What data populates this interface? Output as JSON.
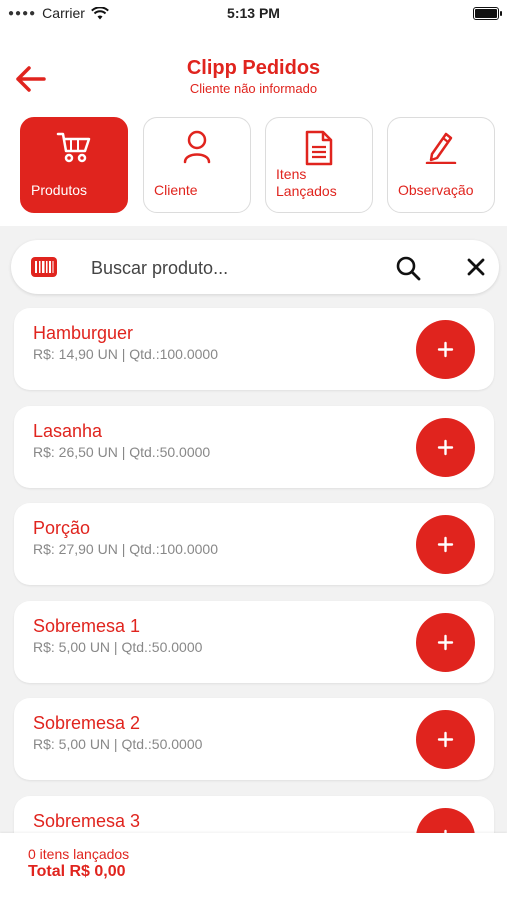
{
  "status_bar": {
    "carrier": "Carrier",
    "time": "5:13 PM"
  },
  "header": {
    "title": "Clipp Pedidos",
    "subtitle": "Cliente não informado"
  },
  "tabs": [
    {
      "label": "Produtos",
      "icon": "cart-icon",
      "active": true
    },
    {
      "label": "Cliente",
      "icon": "user-icon",
      "active": false
    },
    {
      "label": "Itens\nLançados",
      "icon": "document-icon",
      "active": false
    },
    {
      "label": "Observação",
      "icon": "pen-icon",
      "active": false
    }
  ],
  "search": {
    "placeholder": "Buscar produto..."
  },
  "products": [
    {
      "name": "Hamburguer",
      "details": "R$: 14,90 UN |  Qtd.:100.0000"
    },
    {
      "name": "Lasanha",
      "details": "R$: 26,50 UN |  Qtd.:50.0000"
    },
    {
      "name": "Porção",
      "details": "R$: 27,90 UN |  Qtd.:100.0000"
    },
    {
      "name": "Sobremesa 1",
      "details": "R$: 5,00 UN |  Qtd.:50.0000"
    },
    {
      "name": "Sobremesa 2",
      "details": "R$: 5,00 UN |  Qtd.:50.0000"
    },
    {
      "name": "Sobremesa 3",
      "details": ""
    }
  ],
  "footer": {
    "items_count": "0 itens lançados",
    "total": "Total R$ 0,00"
  },
  "colors": {
    "accent": "#e0241e",
    "background": "#f2f2f2"
  }
}
